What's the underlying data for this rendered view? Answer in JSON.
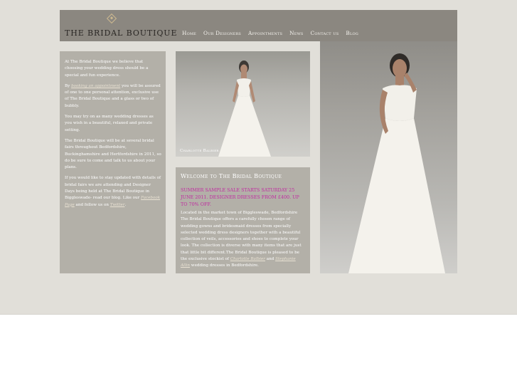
{
  "header": {
    "logo_text": "THE BRIDAL BOUTIQUE",
    "nav": [
      "Home",
      "Our Designers",
      "Appointments",
      "News",
      "Contact us",
      "Blog"
    ]
  },
  "left": {
    "p1": "At The Bridal Boutique we believe that choosing your wedding dress should be a special and fun experience.",
    "p2_link": "booking an appointment",
    "p2_pre": "By ",
    "p2_post": " you will be assured of one to one personal attention, exclusive use of The Bridal Boutique and a glass or two of bubbly.",
    "p3": "You may try on as many wedding dresses as you wish in a beautiful, relaxed and private setting.",
    "p4": "The Bridal Boutique will be at several bridal fairs throughout Bedfordshire, Buckinghamshire and Hertfordshire in 2011, so do be sure to come and talk to us about your plans.",
    "p5_pre": "If you would like to stay updated with details of bridal fairs we are attending and Designer Days being held at The Bridal Boutique in Biggleswade- read our blog. Like our ",
    "p5_link1": "Facebook Page",
    "p5_mid": " and follow us on ",
    "p5_link2": "Twitter",
    "p5_post": "."
  },
  "photo_small": {
    "caption": "Charlotte Balbier"
  },
  "welcome": {
    "title": "Welcome to The Bridal Boutique",
    "promo": "SUMMER SAMPLE SALE STARTS SATURDAY 25 JUNE 2011. DESIGNER DRESSES FROM £400. UP TO 70% OFF.",
    "body_pre": "Located in the market town of Biggleswade, Bedfordshire The Bridal Boutique offers a carefully chosen range of wedding gowns and bridesmaid dresses from specially selected wedding dress designers together with a beautiful collection of veils, accessories and shoes to complete your look. The collection is diverse with many items that are just that little bit different.The Bridal Boutique is pleased to be the exclusive stockist of ",
    "body_link1": "Charlotte Balbier",
    "body_and": " and ",
    "body_link2": "Stephanie Allin",
    "body_post": " wedding dresses in Bedfordshire."
  }
}
